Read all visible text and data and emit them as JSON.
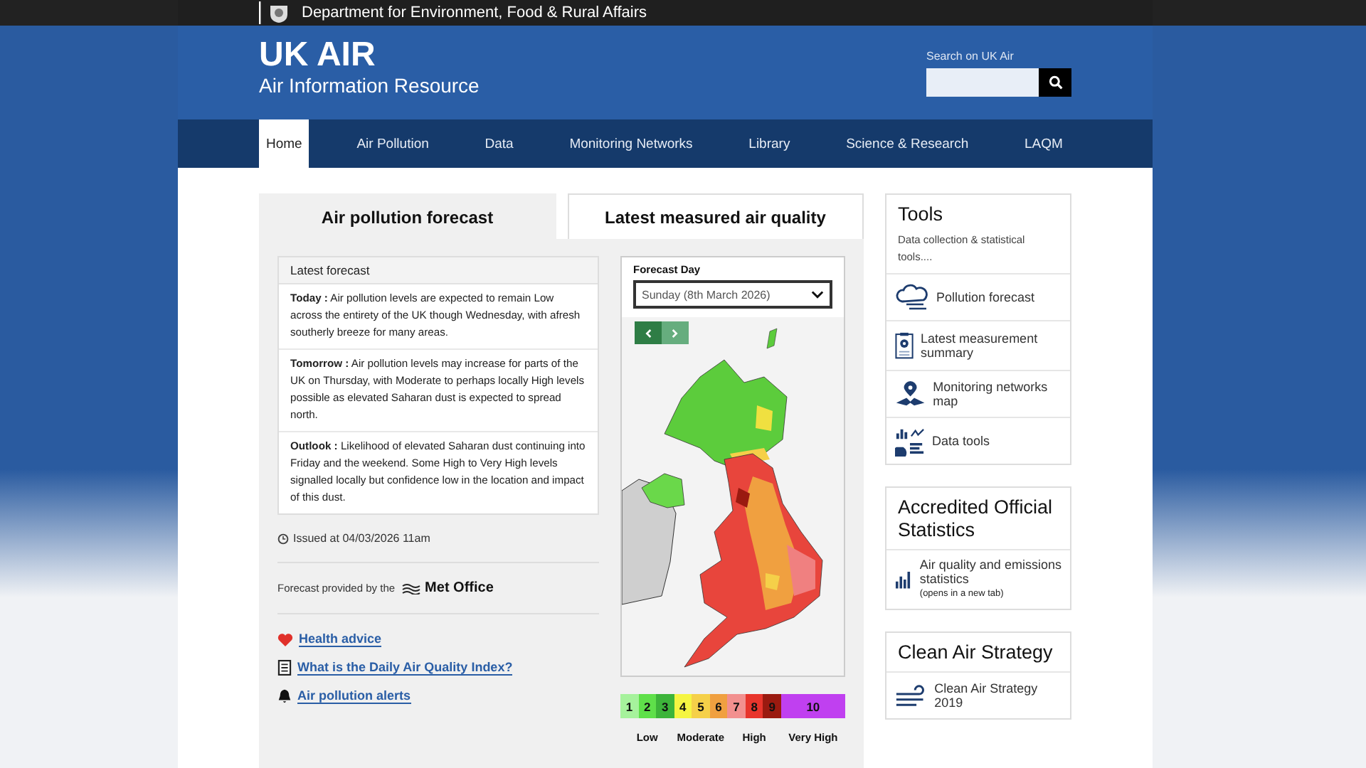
{
  "top_bar": {
    "department": "Department for Environment, Food & Rural Affairs"
  },
  "header": {
    "title": "UK AIR",
    "subtitle": "Air Information Resource",
    "search_label": "Search on UK Air"
  },
  "nav": [
    {
      "label": "Home",
      "selected": true
    },
    {
      "label": "Air Pollution",
      "selected": false
    },
    {
      "label": "Data",
      "selected": false
    },
    {
      "label": "Monitoring Networks",
      "selected": false
    },
    {
      "label": "Library",
      "selected": false
    },
    {
      "label": "Science & Research",
      "selected": false
    },
    {
      "label": "LAQM",
      "selected": false
    }
  ],
  "forecast_tabs": [
    {
      "label": "Air pollution forecast",
      "selected": true
    },
    {
      "label": "Latest measured air quality",
      "selected": false
    }
  ],
  "latest_forecast": {
    "heading": "Latest forecast",
    "entries": [
      {
        "text": "**Today :** Air pollution levels are expected to remain Low across the entirety of the UK though Wednesday, with afresh southerly breeze for many areas."
      },
      {
        "text": "**Tomorrow :** Air pollution levels may increase for parts of the UK on Thursday, with Moderate to perhaps locally High levels possible as elevated Saharan dust is expected to spread north."
      },
      {
        "text": "**Outlook :** Likelihood of elevated Saharan dust continuing into Friday and the weekend. Some High to Very High levels signalled locally but confidence low in the location and impact of this dust."
      }
    ]
  },
  "issued": "Issued at 04/03/2026 11am",
  "provider": {
    "text": "Forecast provided by the",
    "logo": "Met Office"
  },
  "links": [
    {
      "kind": "heart",
      "label": "Health advice"
    },
    {
      "kind": "document",
      "label": "What is the Daily Air Quality Index?"
    },
    {
      "kind": "bell",
      "label": "Air pollution alerts"
    }
  ],
  "map": {
    "label": "Forecast Day",
    "day": "Sunday (8th March 2026)",
    "legend": [
      {
        "label": "Low",
        "levels": [
          {
            "text": "1",
            "color": "#a6f29c"
          },
          {
            "text": "2",
            "color": "#5fe04a"
          },
          {
            "text": "3",
            "color": "#3db43a"
          }
        ]
      },
      {
        "label": "Moderate",
        "levels": [
          {
            "text": "4",
            "color": "#f5f542"
          },
          {
            "text": "5",
            "color": "#f5d049"
          },
          {
            "text": "6",
            "color": "#f0a040"
          }
        ]
      },
      {
        "label": "High",
        "levels": [
          {
            "text": "7",
            "color": "#f2908f"
          },
          {
            "text": "8",
            "color": "#e8352c"
          },
          {
            "text": "9",
            "color": "#9a1a10"
          }
        ]
      },
      {
        "label": "Very High",
        "levels": [
          {
            "text": "10",
            "color": "#c040f0"
          }
        ]
      }
    ]
  },
  "sidebar": [
    {
      "title": "Tools",
      "description": "Data collection & statistical tools....",
      "items": [
        {
          "kind": "cloud",
          "label": "Pollution forecast"
        },
        {
          "kind": "clipboard",
          "label": "Latest measurement summary"
        },
        {
          "kind": "pin",
          "label": "Monitoring networks map"
        },
        {
          "kind": "charts",
          "label": "Data tools"
        }
      ]
    },
    {
      "title": "Accredited Official Statistics",
      "items": [
        {
          "kind": "barchart",
          "label": "Air quality and emissions statistics",
          "note": "(opens in a new tab)"
        }
      ]
    },
    {
      "title": "Clean Air Strategy",
      "items": [
        {
          "kind": "wind",
          "label": "Clean Air Strategy 2019"
        }
      ]
    }
  ]
}
